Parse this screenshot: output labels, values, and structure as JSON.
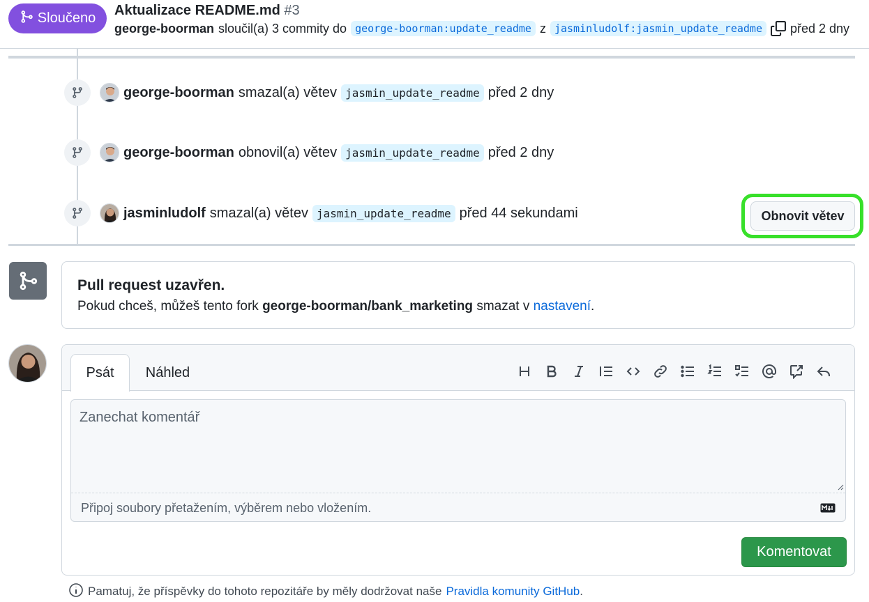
{
  "pr": {
    "state_label": "Sloučeno",
    "title": "Aktualizace README.md",
    "number": "#3",
    "author": "george-boorman",
    "merge_text": "sloučil(a) 3 commity do",
    "base_branch": "george-boorman:update_readme",
    "connector": "z",
    "head_branch": "jasminludolf:jasmin_update_readme",
    "time": "před 2 dny"
  },
  "timeline": [
    {
      "actor": "george-boorman",
      "action": "smazal(a) větev",
      "branch": "jasmin_update_readme",
      "time": "před 2 dny"
    },
    {
      "actor": "george-boorman",
      "action": "obnovil(a) větev",
      "branch": "jasmin_update_readme",
      "time": "před 2 dny"
    },
    {
      "actor": "jasminludolf",
      "action": "smazal(a) větev",
      "branch": "jasmin_update_readme",
      "time": "před 44 sekundami"
    }
  ],
  "restore_button": "Obnovit větev",
  "closed": {
    "title": "Pull request uzavřen.",
    "text_before": "Pokud chceš, můžeš tento fork",
    "repo": "george-boorman/bank_marketing",
    "text_middle": "smazat v",
    "link": "nastavení",
    "text_after": "."
  },
  "composer": {
    "tab_write": "Psát",
    "tab_preview": "Náhled",
    "placeholder": "Zanechat komentář",
    "attach_hint": "Připoj soubory přetažením, výběrem nebo vložením.",
    "submit": "Komentovat"
  },
  "footer": {
    "text": "Pamatuj, že příspěvky do tohoto repozitáře by měly dodržovat naše",
    "link": "Pravidla komunity GitHub",
    "end": "."
  },
  "colors": {
    "merged": "#8250df",
    "highlight": "#38e02a",
    "submit": "#2c974b",
    "link": "#0969da"
  }
}
